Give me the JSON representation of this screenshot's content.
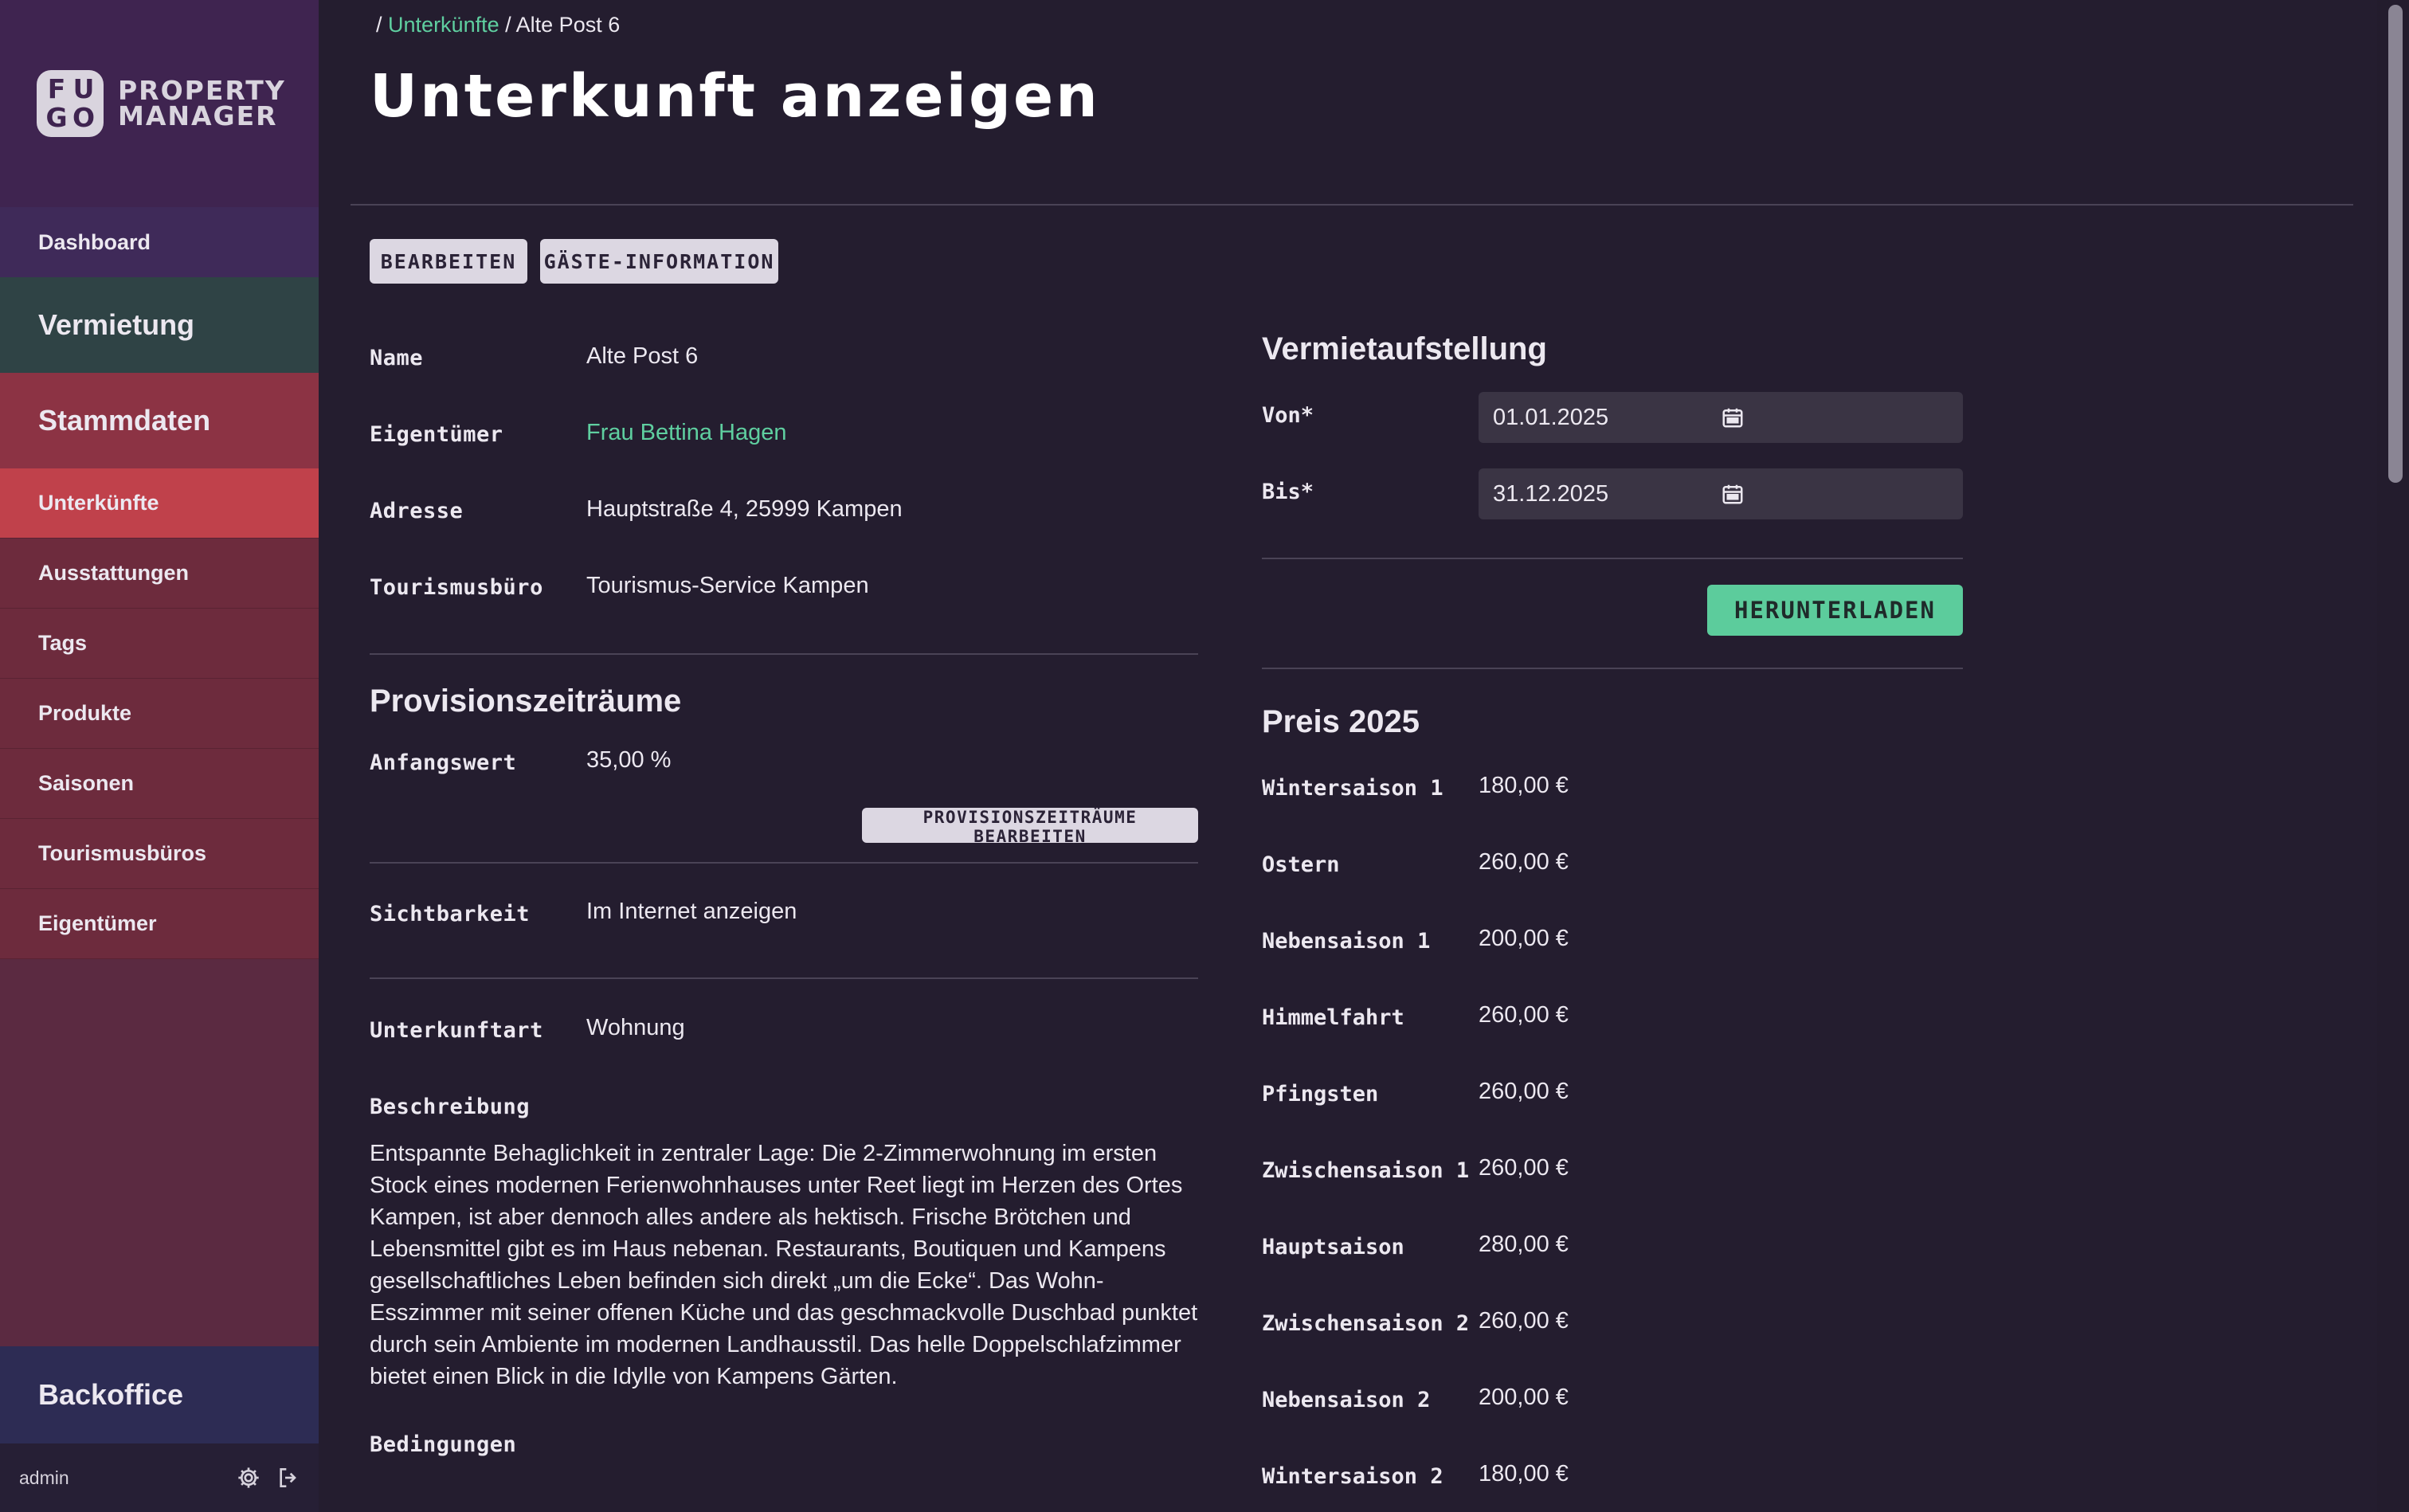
{
  "brand": {
    "logo_letters": [
      "F",
      "U",
      "G",
      "O"
    ],
    "line1": "PROPERTY",
    "line2": "MANAGER"
  },
  "nav": {
    "dashboard": "Dashboard",
    "vermietung": "Vermietung",
    "stammdaten": "Stammdaten",
    "sub_items": [
      "Unterkünfte",
      "Ausstattungen",
      "Tags",
      "Produkte",
      "Saisonen",
      "Tourismusbüros",
      "Eigentümer"
    ],
    "backoffice": "Backoffice"
  },
  "footer": {
    "user": "admin",
    "settings_icon": "gear-icon",
    "logout_icon": "logout-icon"
  },
  "breadcrumb": {
    "sep": "/",
    "parent": "Unterkünfte",
    "current": "Alte Post 6"
  },
  "page_title": "Unterkunft anzeigen",
  "actions": {
    "edit": "BEARBEITEN",
    "guest_info": "GÄSTE-INFORMATION"
  },
  "details": {
    "name_label": "Name",
    "name_value": "Alte Post 6",
    "owner_label": "Eigentümer",
    "owner_value": "Frau Bettina Hagen",
    "address_label": "Adresse",
    "address_value": "Hauptstraße 4, 25999 Kampen",
    "tourism_label": "Tourismusbüro",
    "tourism_value": "Tourismus-Service Kampen"
  },
  "provision": {
    "title": "Provisionszeiträume",
    "start_label": "Anfangswert",
    "start_value": "35,00 %",
    "edit_button": "PROVISIONSZEITRÄUME BEARBEITEN"
  },
  "visibility": {
    "label": "Sichtbarkeit",
    "value": "Im Internet anzeigen"
  },
  "type": {
    "label": "Unterkunftart",
    "value": "Wohnung"
  },
  "description": {
    "label": "Beschreibung",
    "text": "Entspannte Behaglichkeit in zentraler Lage: Die 2-Zimmerwohnung im ersten Stock eines modernen Ferienwohnhauses unter Reet liegt im Herzen des Ortes Kampen, ist aber dennoch alles andere als hektisch. Frische Brötchen und Lebensmittel gibt es im Haus nebenan. Restaurants, Boutiquen und Kampens gesellschaftliches Leben befinden sich direkt „um die Ecke“. Das Wohn-Esszimmer mit seiner offenen Küche und das geschmackvolle Duschbad punktet durch sein Ambiente im modernen Landhausstil. Das helle Doppelschlafzimmer bietet einen Blick in die Idylle von Kampens Gärten."
  },
  "conditions": {
    "label": "Bedingungen"
  },
  "rental_report": {
    "title": "Vermietaufstellung",
    "from_label": "Von*",
    "from_value": "01.01.2025",
    "to_label": "Bis*",
    "to_value": "31.12.2025",
    "download": "HERUNTERLADEN"
  },
  "prices": {
    "title": "Preis 2025",
    "rows": [
      {
        "season": "Wintersaison 1",
        "price": "180,00 €"
      },
      {
        "season": "Ostern",
        "price": "260,00 €"
      },
      {
        "season": "Nebensaison 1",
        "price": "200,00 €"
      },
      {
        "season": "Himmelfahrt",
        "price": "260,00 €"
      },
      {
        "season": "Pfingsten",
        "price": "260,00 €"
      },
      {
        "season": "Zwischensaison 1",
        "price": "260,00 €"
      },
      {
        "season": "Hauptsaison",
        "price": "280,00 €"
      },
      {
        "season": "Zwischensaison 2",
        "price": "260,00 €"
      },
      {
        "season": "Nebensaison 2",
        "price": "200,00 €"
      },
      {
        "season": "Wintersaison 2",
        "price": "180,00 €"
      }
    ]
  },
  "colors": {
    "accent_green": "#5fcfa0",
    "active_nav": "#c0414b",
    "background": "#241d2f"
  }
}
